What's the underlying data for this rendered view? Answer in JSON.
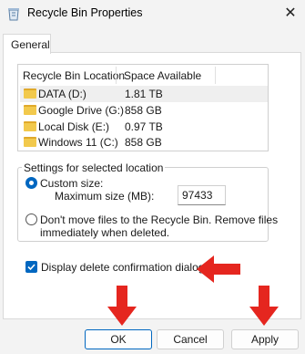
{
  "window": {
    "title": "Recycle Bin Properties",
    "close_glyph": "✕",
    "icon": "recycle-bin-icon"
  },
  "tabs": [
    {
      "label": "General"
    }
  ],
  "list": {
    "headers": [
      "Recycle Bin Location",
      "Space Available"
    ],
    "rows": [
      {
        "name": "DATA (D:)",
        "space": "1.81 TB",
        "selected": true
      },
      {
        "name": "Google Drive (G:)",
        "space": "858 GB",
        "selected": false
      },
      {
        "name": "Local Disk (E:)",
        "space": "0.97 TB",
        "selected": false
      },
      {
        "name": "Windows 11 (C:)",
        "space": "858 GB",
        "selected": false
      }
    ]
  },
  "settings": {
    "group_label": "Settings for selected location",
    "custom_size_label": "Custom size:",
    "custom_size_selected": true,
    "max_size_label": "Maximum size (MB):",
    "max_size_value": "97433",
    "dont_move_line1": "Don't move files to the Recycle Bin. Remove files",
    "dont_move_line2": "immediately when deleted.",
    "dont_move_selected": false
  },
  "confirm": {
    "label": "Display delete confirmation dialog",
    "checked": true
  },
  "buttons": {
    "ok": "OK",
    "cancel": "Cancel",
    "apply": "Apply"
  },
  "colors": {
    "accent": "#0067c0",
    "arrow": "#e5261f",
    "folder": "#f2c94c"
  }
}
